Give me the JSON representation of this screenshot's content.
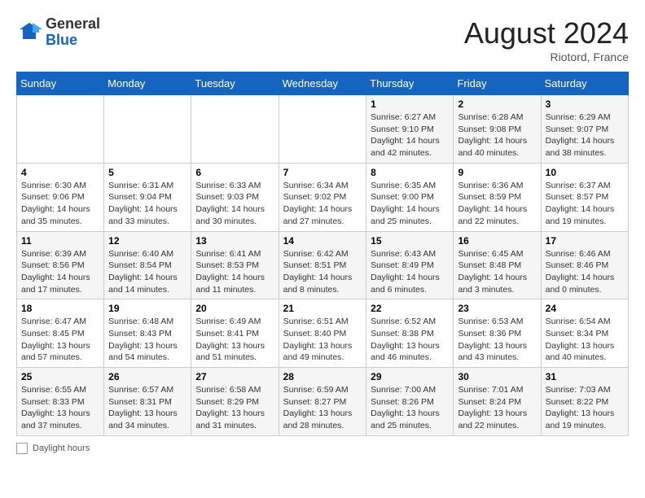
{
  "logo": {
    "general": "General",
    "blue": "Blue"
  },
  "header": {
    "month_year": "August 2024",
    "location": "Riotord, France"
  },
  "days_of_week": [
    "Sunday",
    "Monday",
    "Tuesday",
    "Wednesday",
    "Thursday",
    "Friday",
    "Saturday"
  ],
  "weeks": [
    [
      {
        "num": "",
        "detail": ""
      },
      {
        "num": "",
        "detail": ""
      },
      {
        "num": "",
        "detail": ""
      },
      {
        "num": "",
        "detail": ""
      },
      {
        "num": "1",
        "detail": "Sunrise: 6:27 AM\nSunset: 9:10 PM\nDaylight: 14 hours and 42 minutes."
      },
      {
        "num": "2",
        "detail": "Sunrise: 6:28 AM\nSunset: 9:08 PM\nDaylight: 14 hours and 40 minutes."
      },
      {
        "num": "3",
        "detail": "Sunrise: 6:29 AM\nSunset: 9:07 PM\nDaylight: 14 hours and 38 minutes."
      }
    ],
    [
      {
        "num": "4",
        "detail": "Sunrise: 6:30 AM\nSunset: 9:06 PM\nDaylight: 14 hours and 35 minutes."
      },
      {
        "num": "5",
        "detail": "Sunrise: 6:31 AM\nSunset: 9:04 PM\nDaylight: 14 hours and 33 minutes."
      },
      {
        "num": "6",
        "detail": "Sunrise: 6:33 AM\nSunset: 9:03 PM\nDaylight: 14 hours and 30 minutes."
      },
      {
        "num": "7",
        "detail": "Sunrise: 6:34 AM\nSunset: 9:02 PM\nDaylight: 14 hours and 27 minutes."
      },
      {
        "num": "8",
        "detail": "Sunrise: 6:35 AM\nSunset: 9:00 PM\nDaylight: 14 hours and 25 minutes."
      },
      {
        "num": "9",
        "detail": "Sunrise: 6:36 AM\nSunset: 8:59 PM\nDaylight: 14 hours and 22 minutes."
      },
      {
        "num": "10",
        "detail": "Sunrise: 6:37 AM\nSunset: 8:57 PM\nDaylight: 14 hours and 19 minutes."
      }
    ],
    [
      {
        "num": "11",
        "detail": "Sunrise: 6:39 AM\nSunset: 8:56 PM\nDaylight: 14 hours and 17 minutes."
      },
      {
        "num": "12",
        "detail": "Sunrise: 6:40 AM\nSunset: 8:54 PM\nDaylight: 14 hours and 14 minutes."
      },
      {
        "num": "13",
        "detail": "Sunrise: 6:41 AM\nSunset: 8:53 PM\nDaylight: 14 hours and 11 minutes."
      },
      {
        "num": "14",
        "detail": "Sunrise: 6:42 AM\nSunset: 8:51 PM\nDaylight: 14 hours and 8 minutes."
      },
      {
        "num": "15",
        "detail": "Sunrise: 6:43 AM\nSunset: 8:49 PM\nDaylight: 14 hours and 6 minutes."
      },
      {
        "num": "16",
        "detail": "Sunrise: 6:45 AM\nSunset: 8:48 PM\nDaylight: 14 hours and 3 minutes."
      },
      {
        "num": "17",
        "detail": "Sunrise: 6:46 AM\nSunset: 8:46 PM\nDaylight: 14 hours and 0 minutes."
      }
    ],
    [
      {
        "num": "18",
        "detail": "Sunrise: 6:47 AM\nSunset: 8:45 PM\nDaylight: 13 hours and 57 minutes."
      },
      {
        "num": "19",
        "detail": "Sunrise: 6:48 AM\nSunset: 8:43 PM\nDaylight: 13 hours and 54 minutes."
      },
      {
        "num": "20",
        "detail": "Sunrise: 6:49 AM\nSunset: 8:41 PM\nDaylight: 13 hours and 51 minutes."
      },
      {
        "num": "21",
        "detail": "Sunrise: 6:51 AM\nSunset: 8:40 PM\nDaylight: 13 hours and 49 minutes."
      },
      {
        "num": "22",
        "detail": "Sunrise: 6:52 AM\nSunset: 8:38 PM\nDaylight: 13 hours and 46 minutes."
      },
      {
        "num": "23",
        "detail": "Sunrise: 6:53 AM\nSunset: 8:36 PM\nDaylight: 13 hours and 43 minutes."
      },
      {
        "num": "24",
        "detail": "Sunrise: 6:54 AM\nSunset: 8:34 PM\nDaylight: 13 hours and 40 minutes."
      }
    ],
    [
      {
        "num": "25",
        "detail": "Sunrise: 6:55 AM\nSunset: 8:33 PM\nDaylight: 13 hours and 37 minutes."
      },
      {
        "num": "26",
        "detail": "Sunrise: 6:57 AM\nSunset: 8:31 PM\nDaylight: 13 hours and 34 minutes."
      },
      {
        "num": "27",
        "detail": "Sunrise: 6:58 AM\nSunset: 8:29 PM\nDaylight: 13 hours and 31 minutes."
      },
      {
        "num": "28",
        "detail": "Sunrise: 6:59 AM\nSunset: 8:27 PM\nDaylight: 13 hours and 28 minutes."
      },
      {
        "num": "29",
        "detail": "Sunrise: 7:00 AM\nSunset: 8:26 PM\nDaylight: 13 hours and 25 minutes."
      },
      {
        "num": "30",
        "detail": "Sunrise: 7:01 AM\nSunset: 8:24 PM\nDaylight: 13 hours and 22 minutes."
      },
      {
        "num": "31",
        "detail": "Sunrise: 7:03 AM\nSunset: 8:22 PM\nDaylight: 13 hours and 19 minutes."
      }
    ]
  ],
  "footer": {
    "label": "Daylight hours"
  }
}
